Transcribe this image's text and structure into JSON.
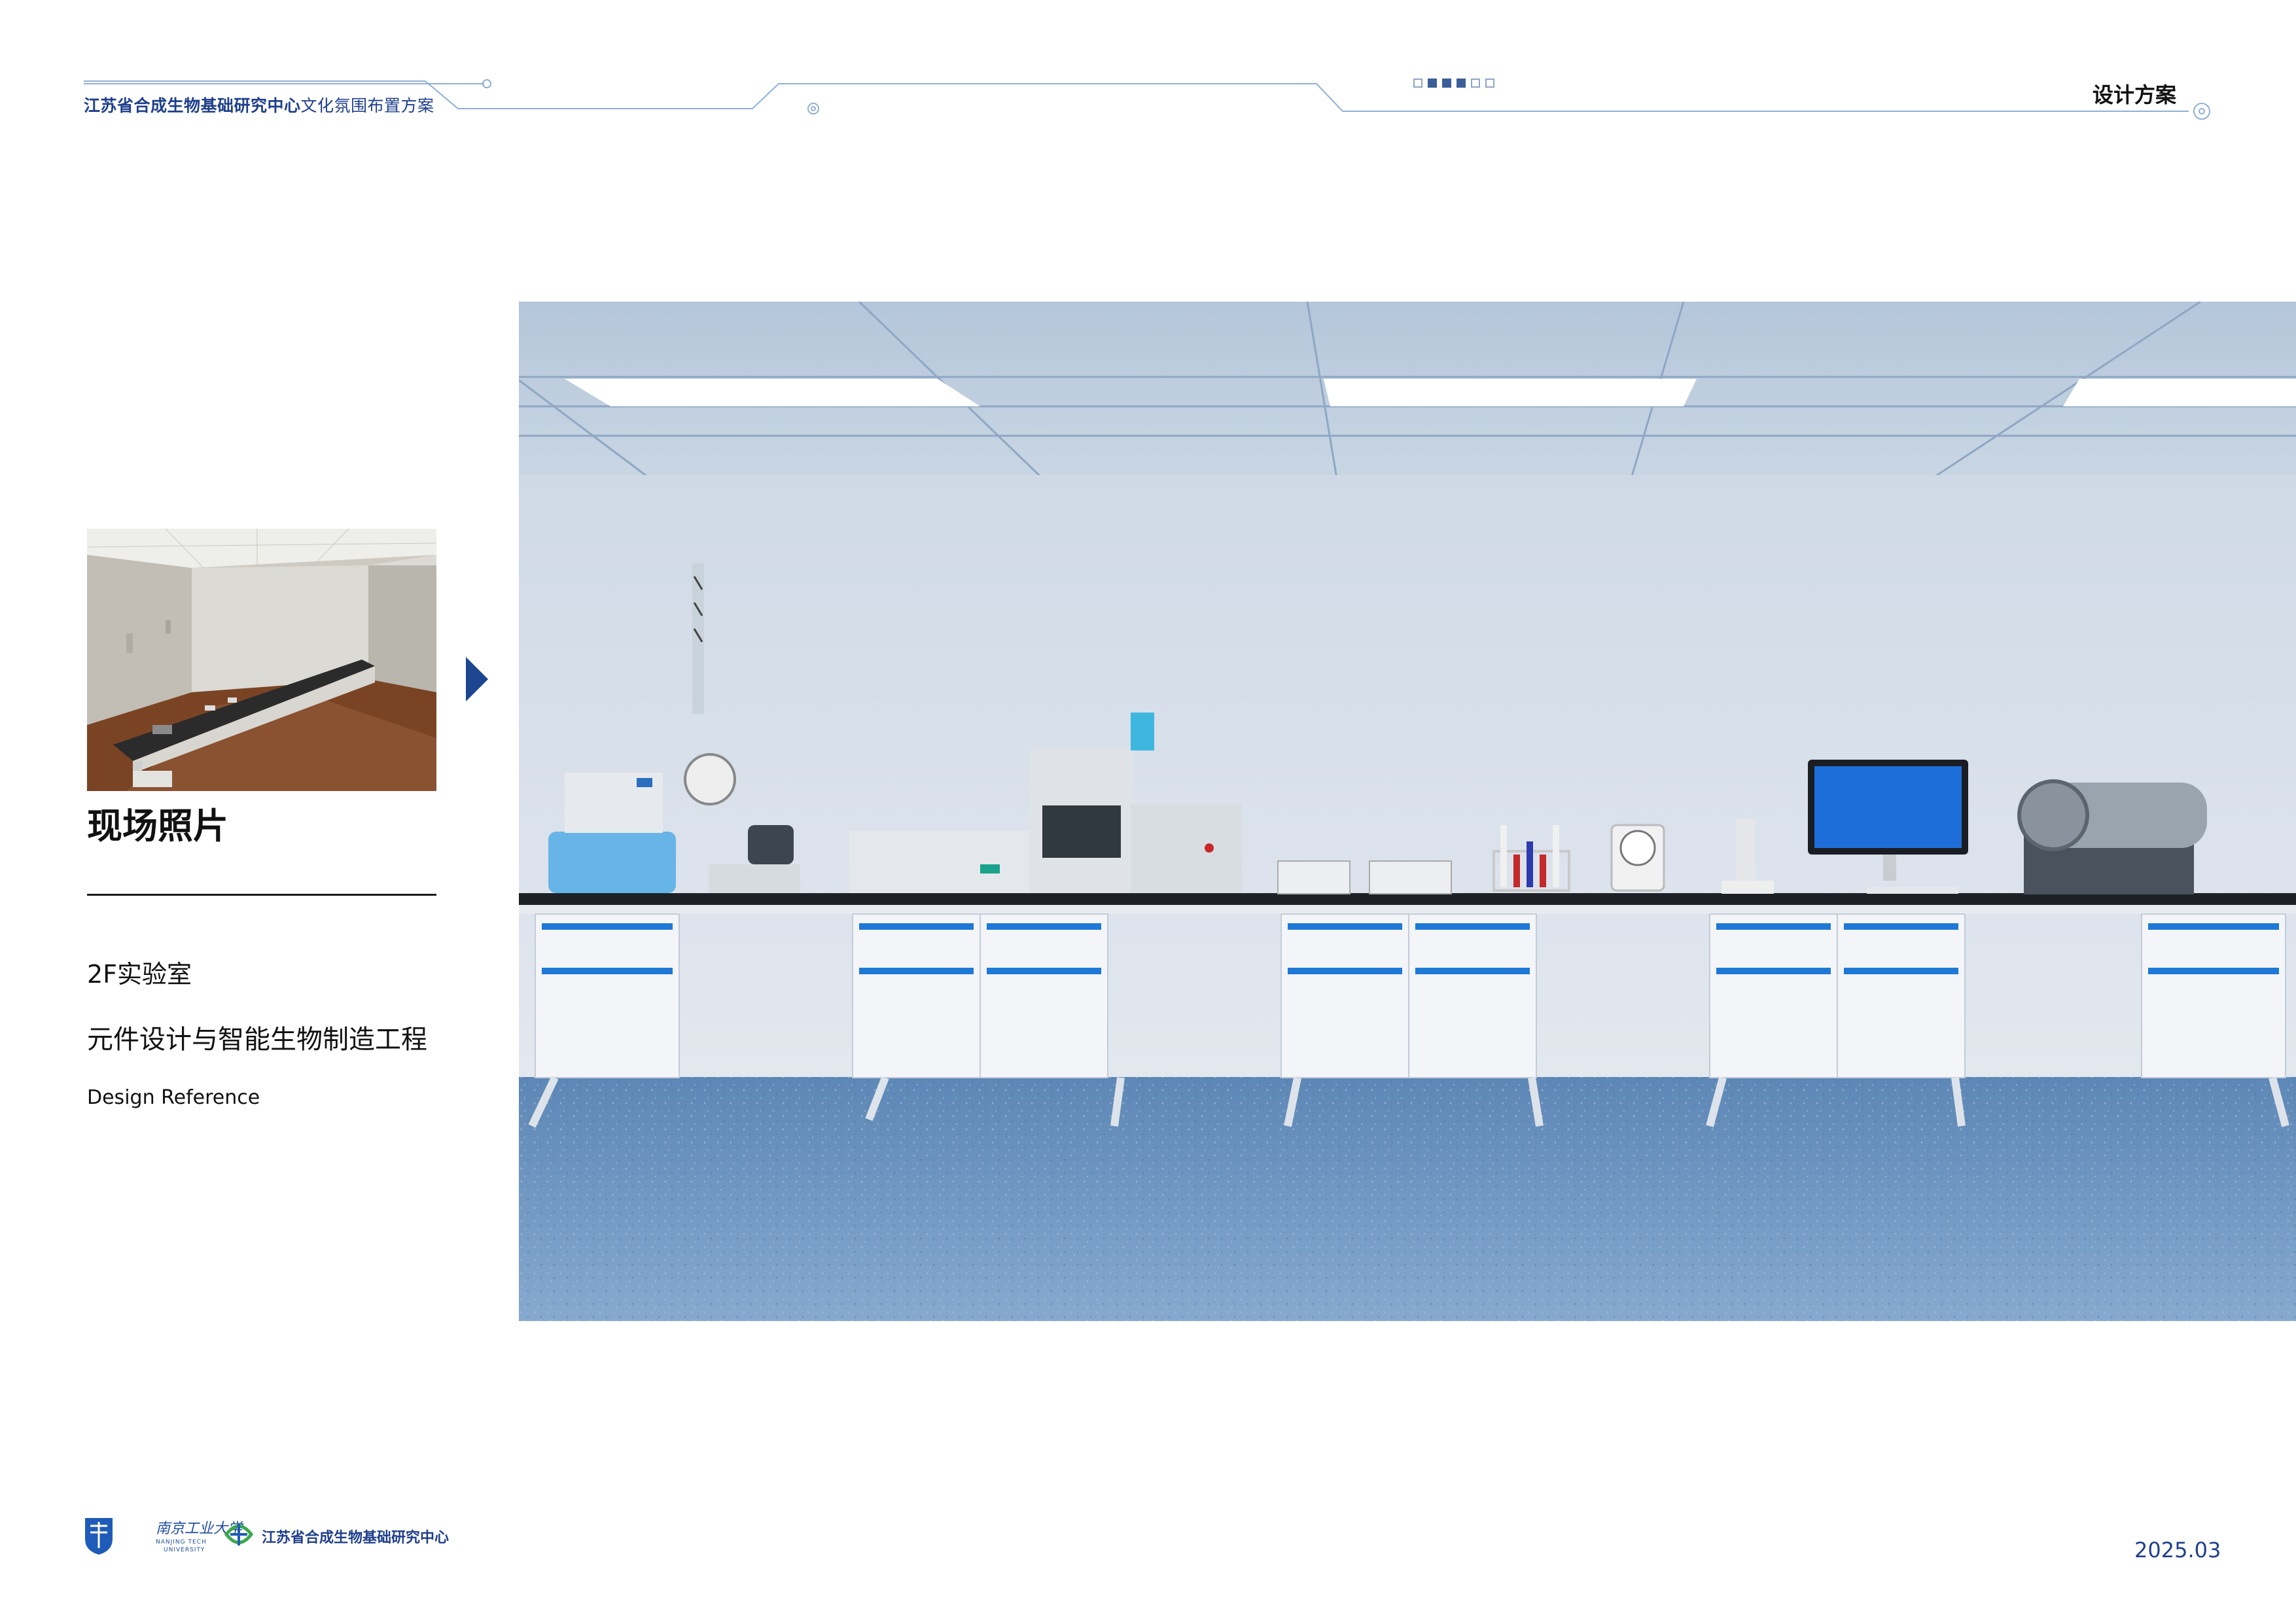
{
  "header": {
    "title_bold": "江苏省合成生物基础研究中心",
    "title_rest": "文化氛围布置方案",
    "section": "设计方案",
    "pager_count": 6,
    "pager_active": [
      1,
      2,
      3
    ]
  },
  "left": {
    "photo_heading": "现场照片",
    "room": "2F实验室",
    "lab_name": "元件设计与智能生物制造工程",
    "design_reference": "Design Reference"
  },
  "footer": {
    "university_cn": "南京工业大学",
    "university_en_line1": "NANJING TECH",
    "university_en_line2": "UNIVERSITY",
    "center_name": "江苏省合成生物基础研究中心",
    "date": "2025.03"
  },
  "colors": {
    "brand_blue": "#1f3f8c",
    "accent_blue": "#1c4790",
    "line_blue": "#8fb0d8",
    "floor_blue": "#6f9bc8",
    "wall": "#dfe6ee"
  }
}
